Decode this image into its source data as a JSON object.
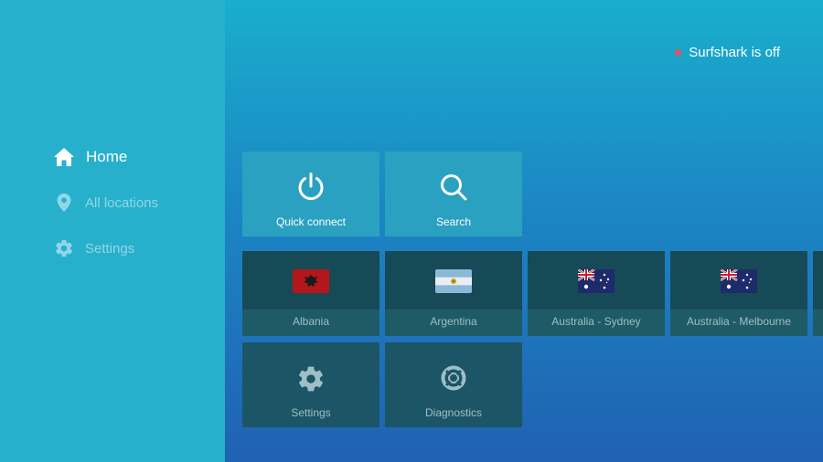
{
  "colors": {
    "sidebar_bg": "#27b0cc",
    "status_off": "#e8505b",
    "nav_active": "#ffffff",
    "nav_inactive": "#92d6e6"
  },
  "sidebar": {
    "items": [
      {
        "label": "Home",
        "icon": "home-icon",
        "active": true
      },
      {
        "label": "All locations",
        "icon": "location-pin-icon",
        "active": false
      },
      {
        "label": "Settings",
        "icon": "gear-icon",
        "active": false
      }
    ]
  },
  "status": {
    "text": "Surfshark is off",
    "state": "off"
  },
  "actions": [
    {
      "label": "Quick connect",
      "icon": "power-icon"
    },
    {
      "label": "Search",
      "icon": "search-icon"
    }
  ],
  "locations": [
    {
      "label": "Albania",
      "flag": "albania-flag-icon"
    },
    {
      "label": "Argentina",
      "flag": "argentina-flag-icon"
    },
    {
      "label": "Australia - Sydney",
      "flag": "australia-flag-icon"
    },
    {
      "label": "Australia - Melbourne",
      "flag": "australia-flag-icon"
    }
  ],
  "tools": [
    {
      "label": "Settings",
      "icon": "gear-icon"
    },
    {
      "label": "Diagnostics",
      "icon": "lifebuoy-icon"
    }
  ]
}
